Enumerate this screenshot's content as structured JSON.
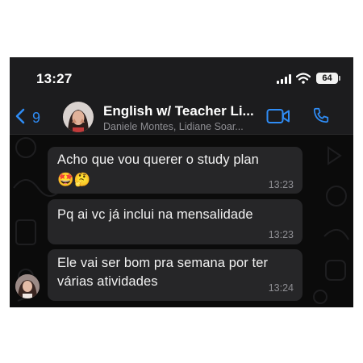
{
  "status_bar": {
    "time": "13:27",
    "battery": "64",
    "icons": [
      "signal-icon",
      "wifi-icon",
      "battery-icon"
    ]
  },
  "header": {
    "back_count": "9",
    "title": "English w/ Teacher Li...",
    "subtitle": "Daniele Montes, Lidiane Soar...",
    "icons": [
      "back-chevron-icon",
      "video-call-icon",
      "phone-call-icon"
    ]
  },
  "messages": [
    {
      "lines": [
        "Acho que vou querer o study plan",
        "🤩🤔"
      ],
      "time": "13:23"
    },
    {
      "lines": [
        "Pq ai vc já inclui na mensalidade"
      ],
      "time": "13:23"
    },
    {
      "lines": [
        "Ele vai ser bom pra semana por ter",
        "várias atividades"
      ],
      "time": "13:24"
    }
  ],
  "colors": {
    "accent_blue": "#2f8cf5",
    "bubble": "#262628",
    "background": "#0b0b0b",
    "header": "#1c1c1e",
    "meta_gray": "#8e8e93"
  }
}
